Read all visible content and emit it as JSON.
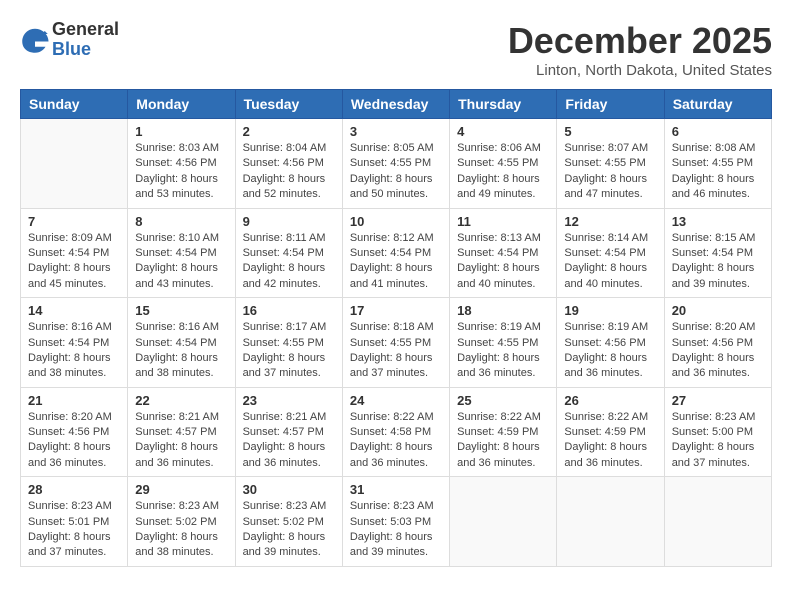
{
  "logo": {
    "general": "General",
    "blue": "Blue"
  },
  "title": "December 2025",
  "location": "Linton, North Dakota, United States",
  "days_of_week": [
    "Sunday",
    "Monday",
    "Tuesday",
    "Wednesday",
    "Thursday",
    "Friday",
    "Saturday"
  ],
  "weeks": [
    [
      {
        "day": "",
        "sunrise": "",
        "sunset": "",
        "daylight": ""
      },
      {
        "day": "1",
        "sunrise": "Sunrise: 8:03 AM",
        "sunset": "Sunset: 4:56 PM",
        "daylight": "Daylight: 8 hours and 53 minutes."
      },
      {
        "day": "2",
        "sunrise": "Sunrise: 8:04 AM",
        "sunset": "Sunset: 4:56 PM",
        "daylight": "Daylight: 8 hours and 52 minutes."
      },
      {
        "day": "3",
        "sunrise": "Sunrise: 8:05 AM",
        "sunset": "Sunset: 4:55 PM",
        "daylight": "Daylight: 8 hours and 50 minutes."
      },
      {
        "day": "4",
        "sunrise": "Sunrise: 8:06 AM",
        "sunset": "Sunset: 4:55 PM",
        "daylight": "Daylight: 8 hours and 49 minutes."
      },
      {
        "day": "5",
        "sunrise": "Sunrise: 8:07 AM",
        "sunset": "Sunset: 4:55 PM",
        "daylight": "Daylight: 8 hours and 47 minutes."
      },
      {
        "day": "6",
        "sunrise": "Sunrise: 8:08 AM",
        "sunset": "Sunset: 4:55 PM",
        "daylight": "Daylight: 8 hours and 46 minutes."
      }
    ],
    [
      {
        "day": "7",
        "sunrise": "Sunrise: 8:09 AM",
        "sunset": "Sunset: 4:54 PM",
        "daylight": "Daylight: 8 hours and 45 minutes."
      },
      {
        "day": "8",
        "sunrise": "Sunrise: 8:10 AM",
        "sunset": "Sunset: 4:54 PM",
        "daylight": "Daylight: 8 hours and 43 minutes."
      },
      {
        "day": "9",
        "sunrise": "Sunrise: 8:11 AM",
        "sunset": "Sunset: 4:54 PM",
        "daylight": "Daylight: 8 hours and 42 minutes."
      },
      {
        "day": "10",
        "sunrise": "Sunrise: 8:12 AM",
        "sunset": "Sunset: 4:54 PM",
        "daylight": "Daylight: 8 hours and 41 minutes."
      },
      {
        "day": "11",
        "sunrise": "Sunrise: 8:13 AM",
        "sunset": "Sunset: 4:54 PM",
        "daylight": "Daylight: 8 hours and 40 minutes."
      },
      {
        "day": "12",
        "sunrise": "Sunrise: 8:14 AM",
        "sunset": "Sunset: 4:54 PM",
        "daylight": "Daylight: 8 hours and 40 minutes."
      },
      {
        "day": "13",
        "sunrise": "Sunrise: 8:15 AM",
        "sunset": "Sunset: 4:54 PM",
        "daylight": "Daylight: 8 hours and 39 minutes."
      }
    ],
    [
      {
        "day": "14",
        "sunrise": "Sunrise: 8:16 AM",
        "sunset": "Sunset: 4:54 PM",
        "daylight": "Daylight: 8 hours and 38 minutes."
      },
      {
        "day": "15",
        "sunrise": "Sunrise: 8:16 AM",
        "sunset": "Sunset: 4:54 PM",
        "daylight": "Daylight: 8 hours and 38 minutes."
      },
      {
        "day": "16",
        "sunrise": "Sunrise: 8:17 AM",
        "sunset": "Sunset: 4:55 PM",
        "daylight": "Daylight: 8 hours and 37 minutes."
      },
      {
        "day": "17",
        "sunrise": "Sunrise: 8:18 AM",
        "sunset": "Sunset: 4:55 PM",
        "daylight": "Daylight: 8 hours and 37 minutes."
      },
      {
        "day": "18",
        "sunrise": "Sunrise: 8:19 AM",
        "sunset": "Sunset: 4:55 PM",
        "daylight": "Daylight: 8 hours and 36 minutes."
      },
      {
        "day": "19",
        "sunrise": "Sunrise: 8:19 AM",
        "sunset": "Sunset: 4:56 PM",
        "daylight": "Daylight: 8 hours and 36 minutes."
      },
      {
        "day": "20",
        "sunrise": "Sunrise: 8:20 AM",
        "sunset": "Sunset: 4:56 PM",
        "daylight": "Daylight: 8 hours and 36 minutes."
      }
    ],
    [
      {
        "day": "21",
        "sunrise": "Sunrise: 8:20 AM",
        "sunset": "Sunset: 4:56 PM",
        "daylight": "Daylight: 8 hours and 36 minutes."
      },
      {
        "day": "22",
        "sunrise": "Sunrise: 8:21 AM",
        "sunset": "Sunset: 4:57 PM",
        "daylight": "Daylight: 8 hours and 36 minutes."
      },
      {
        "day": "23",
        "sunrise": "Sunrise: 8:21 AM",
        "sunset": "Sunset: 4:57 PM",
        "daylight": "Daylight: 8 hours and 36 minutes."
      },
      {
        "day": "24",
        "sunrise": "Sunrise: 8:22 AM",
        "sunset": "Sunset: 4:58 PM",
        "daylight": "Daylight: 8 hours and 36 minutes."
      },
      {
        "day": "25",
        "sunrise": "Sunrise: 8:22 AM",
        "sunset": "Sunset: 4:59 PM",
        "daylight": "Daylight: 8 hours and 36 minutes."
      },
      {
        "day": "26",
        "sunrise": "Sunrise: 8:22 AM",
        "sunset": "Sunset: 4:59 PM",
        "daylight": "Daylight: 8 hours and 36 minutes."
      },
      {
        "day": "27",
        "sunrise": "Sunrise: 8:23 AM",
        "sunset": "Sunset: 5:00 PM",
        "daylight": "Daylight: 8 hours and 37 minutes."
      }
    ],
    [
      {
        "day": "28",
        "sunrise": "Sunrise: 8:23 AM",
        "sunset": "Sunset: 5:01 PM",
        "daylight": "Daylight: 8 hours and 37 minutes."
      },
      {
        "day": "29",
        "sunrise": "Sunrise: 8:23 AM",
        "sunset": "Sunset: 5:02 PM",
        "daylight": "Daylight: 8 hours and 38 minutes."
      },
      {
        "day": "30",
        "sunrise": "Sunrise: 8:23 AM",
        "sunset": "Sunset: 5:02 PM",
        "daylight": "Daylight: 8 hours and 39 minutes."
      },
      {
        "day": "31",
        "sunrise": "Sunrise: 8:23 AM",
        "sunset": "Sunset: 5:03 PM",
        "daylight": "Daylight: 8 hours and 39 minutes."
      },
      {
        "day": "",
        "sunrise": "",
        "sunset": "",
        "daylight": ""
      },
      {
        "day": "",
        "sunrise": "",
        "sunset": "",
        "daylight": ""
      },
      {
        "day": "",
        "sunrise": "",
        "sunset": "",
        "daylight": ""
      }
    ]
  ]
}
